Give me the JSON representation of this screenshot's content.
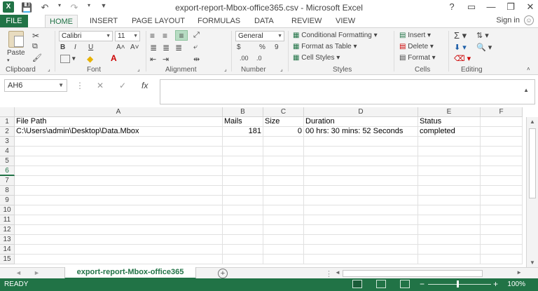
{
  "window": {
    "title": "export-report-Mbox-office365.csv - Microsoft Excel",
    "app_logo": "X",
    "controls": [
      "?",
      "▭",
      "—",
      "❐",
      "✕"
    ]
  },
  "qat": {
    "save_icon": "save-icon",
    "undo_icon": "undo-icon",
    "redo_icon": "redo-icon"
  },
  "ribbon_tabs": {
    "file": "FILE",
    "tabs": [
      "HOME",
      "INSERT",
      "PAGE LAYOUT",
      "FORMULAS",
      "DATA",
      "REVIEW",
      "VIEW"
    ],
    "active": "HOME",
    "sign_in": "Sign in"
  },
  "ribbon": {
    "clipboard": {
      "paste": "Paste",
      "label": "Clipboard"
    },
    "font": {
      "font_name": "Calibri",
      "font_size": "11",
      "bold": "B",
      "italic": "I",
      "underline": "U",
      "grow": "A˄",
      "shrink": "A˅",
      "label": "Font"
    },
    "alignment": {
      "label": "Alignment"
    },
    "number": {
      "format": "General",
      "currency": "$",
      "percent": "%",
      "comma": "9",
      "label": "Number"
    },
    "styles": {
      "conditional": "Conditional Formatting",
      "table": "Format as Table",
      "cell_styles": "Cell Styles",
      "label": "Styles"
    },
    "cells": {
      "insert": "Insert",
      "delete": "Delete",
      "format": "Format",
      "label": "Cells"
    },
    "editing": {
      "label": "Editing"
    }
  },
  "formula_bar": {
    "name_box": "AH6",
    "cancel": "✕",
    "enter": "✓",
    "fx": "fx",
    "content": ""
  },
  "sheet": {
    "columns": [
      "A",
      "B",
      "C",
      "D",
      "E",
      "F"
    ],
    "rows": [
      "1",
      "2",
      "3",
      "4",
      "5",
      "6",
      "7",
      "8",
      "9",
      "10",
      "11",
      "12",
      "13",
      "14",
      "15"
    ],
    "selected_row": "6",
    "data": [
      [
        "File Path",
        "Mails",
        "Size",
        "Duration",
        "Status",
        ""
      ],
      [
        "C:\\Users\\admin\\Desktop\\Data.Mbox",
        "181",
        "0",
        "00 hrs: 30 mins: 52 Seconds",
        "completed",
        ""
      ]
    ]
  },
  "sheet_tabs": {
    "active_sheet": "export-report-Mbox-office365",
    "add_sheet": "+"
  },
  "status_bar": {
    "status": "READY",
    "zoom": "100%",
    "zoom_minus": "−",
    "zoom_plus": "+"
  },
  "colors": {
    "accent": "#217346",
    "ribbon_bg": "#f3f3f3"
  }
}
